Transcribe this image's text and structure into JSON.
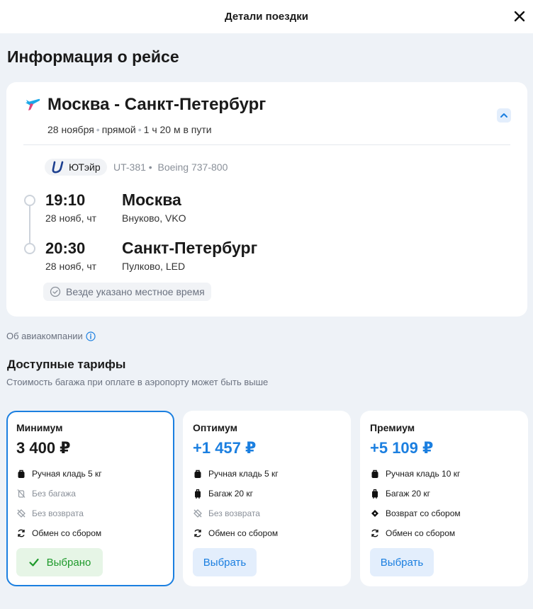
{
  "header": {
    "title": "Детали поездки"
  },
  "flight_info": {
    "heading": "Информация о рейсе",
    "route": "Москва - Санкт-Петербург",
    "date": "28 ноября",
    "type": "прямой",
    "duration": "1 ч 20 м в пути",
    "airline": "ЮТэйр",
    "flight_number": "UT-381",
    "aircraft": "Boeing 737-800",
    "departure": {
      "time": "19:10",
      "date": "28 нояб, чт",
      "city": "Москва",
      "airport": "Внуково, VKO"
    },
    "arrival": {
      "time": "20:30",
      "date": "28 нояб, чт",
      "city": "Санкт-Петербург",
      "airport": "Пулково, LED"
    },
    "timezone_note": "Везде указано местное время"
  },
  "about_airline": "Об авиакомпании",
  "tariffs_section": {
    "heading": "Доступные тарифы",
    "subheading": "Стоимость багажа при оплате в аэропорту может быть выше",
    "tariffs": [
      {
        "name": "Минимум",
        "price": "3 400 ₽",
        "selected": true,
        "button": "Выбрано",
        "features": [
          {
            "text": "Ручная кладь 5 кг",
            "icon": "hand-luggage-icon",
            "available": true
          },
          {
            "text": "Без багажа",
            "icon": "no-baggage-icon",
            "available": false
          },
          {
            "text": "Без возврата",
            "icon": "no-refund-icon",
            "available": false
          },
          {
            "text": "Обмен со сбором",
            "icon": "exchange-icon",
            "available": true
          }
        ]
      },
      {
        "name": "Оптимум",
        "price": "+1 457 ₽",
        "selected": false,
        "button": "Выбрать",
        "features": [
          {
            "text": "Ручная кладь 5 кг",
            "icon": "hand-luggage-icon",
            "available": true
          },
          {
            "text": "Багаж 20 кг",
            "icon": "baggage-icon",
            "available": true
          },
          {
            "text": "Без возврата",
            "icon": "no-refund-icon",
            "available": false
          },
          {
            "text": "Обмен со сбором",
            "icon": "exchange-icon",
            "available": true
          }
        ]
      },
      {
        "name": "Премиум",
        "price": "+5 109 ₽",
        "selected": false,
        "button": "Выбрать",
        "features": [
          {
            "text": "Ручная кладь 10 кг",
            "icon": "hand-luggage-icon",
            "available": true
          },
          {
            "text": "Багаж 20 кг",
            "icon": "baggage-icon",
            "available": true
          },
          {
            "text": "Возврат со сбором",
            "icon": "refund-icon",
            "available": true
          },
          {
            "text": "Обмен со сбором",
            "icon": "exchange-icon",
            "available": true
          }
        ]
      }
    ]
  },
  "colors": {
    "accent": "#1b7fe0",
    "selected_bg": "#e6f5e6",
    "selected_text": "#1f9a2c",
    "background": "#eef2f7"
  }
}
